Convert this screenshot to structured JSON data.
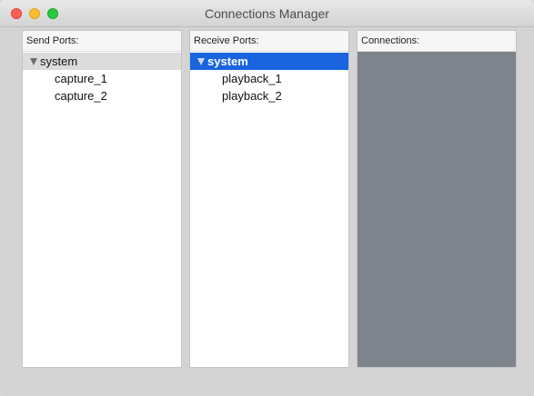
{
  "window": {
    "title": "Connections Manager"
  },
  "send_ports": {
    "header": "Send Ports:",
    "group": "system",
    "items": [
      "capture_1",
      "capture_2"
    ]
  },
  "receive_ports": {
    "header": "Receive Ports:",
    "group": "system",
    "items": [
      "playback_1",
      "playback_2"
    ]
  },
  "connections": {
    "header": "Connections:"
  },
  "colors": {
    "selection": "#1a64e0",
    "connections_background": "#7d848b"
  }
}
